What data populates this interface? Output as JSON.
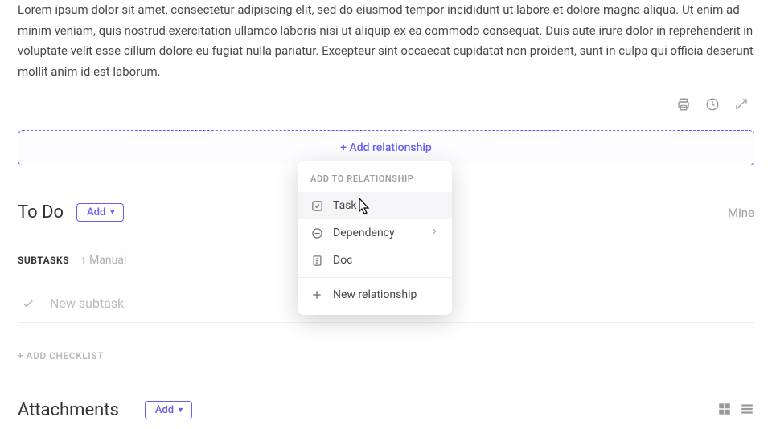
{
  "description": "Lorem ipsum dolor sit amet, consectetur adipiscing elit, sed do eiusmod tempor incididunt ut labore et dolore magna aliqua. Ut enim ad minim veniam, quis nostrud exercitation ullamco laboris nisi ut aliquip ex ea commodo consequat. Duis aute irure dolor in reprehenderit in voluptate velit esse cillum dolore eu fugiat nulla pariatur. Excepteur sint occaecat cupidatat non proident, sunt in culpa qui officia deserunt mollit anim id est laborum.",
  "relationship": {
    "add_label": "+ Add relationship"
  },
  "popup": {
    "header": "ADD TO RELATIONSHIP",
    "items": [
      {
        "label": "Task"
      },
      {
        "label": "Dependency"
      },
      {
        "label": "Doc"
      }
    ],
    "new_label": "New relationship"
  },
  "todo": {
    "title": "To Do",
    "add_label": "Add",
    "mine_label": "Mine"
  },
  "subtasks": {
    "label": "SUBTASKS",
    "sort": "Manual",
    "placeholder": "New subtask"
  },
  "checklist": {
    "add_label": "+ ADD CHECKLIST"
  },
  "attachments": {
    "title": "Attachments",
    "add_label": "Add"
  }
}
